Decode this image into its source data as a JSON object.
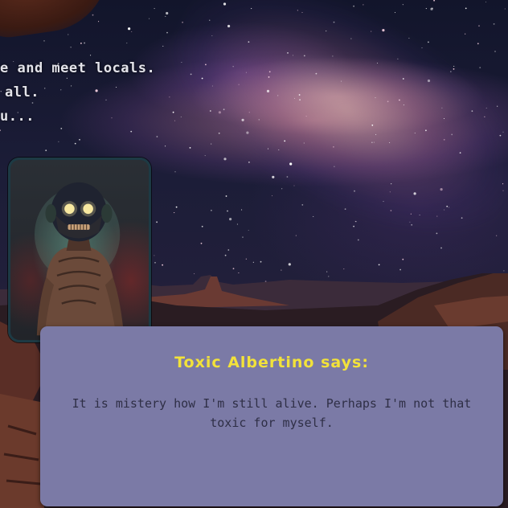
{
  "intro": {
    "lines": [
      "e and meet locals.",
      "all.",
      "u..."
    ]
  },
  "character": {
    "name": "Toxic Albertino",
    "portrait_icon": "zombie-portrait"
  },
  "dialog": {
    "speaker_line": "Toxic Albertino says:",
    "text": "It is mistery how I'm still alive. Perhaps I'm not that toxic for myself."
  },
  "colors": {
    "dialog_bg": "#7b7aa6",
    "speaker_text": "#f2e23a",
    "speech_text": "#2f2f46",
    "intro_text": "#e3e3ea"
  }
}
